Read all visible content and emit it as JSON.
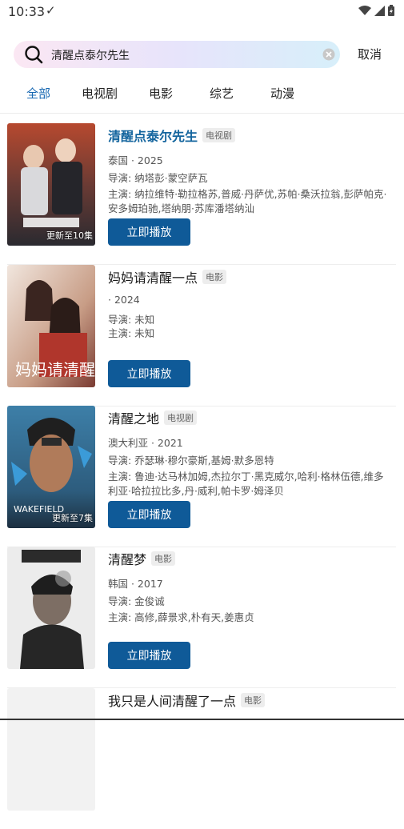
{
  "status_bar": {
    "time": "10:33",
    "check": "✓"
  },
  "search": {
    "query": "清醒点泰尔先生",
    "cancel_label": "取消"
  },
  "tabs": [
    {
      "label": "全部",
      "active": true
    },
    {
      "label": "电视剧",
      "active": false
    },
    {
      "label": "电影",
      "active": false
    },
    {
      "label": "综艺",
      "active": false
    },
    {
      "label": "动漫",
      "active": false
    }
  ],
  "results": [
    {
      "title": "清醒点泰尔先生",
      "tag": "电视剧",
      "meta": "泰国 · 2025",
      "director": "导演:  纳塔彭·蒙空萨瓦",
      "cast": "主演:  纳拉维特·勒拉格苏,普威·丹萨优,苏帕·桑沃拉翁,彭萨帕克·安多姆珀驰,塔纳朋·苏库潘塔纳汕",
      "badge": "更新至10集",
      "play_label": "立即播放"
    },
    {
      "title": "妈妈请清醒一点",
      "tag": "电影",
      "meta": " · 2024",
      "director": "导演:  未知",
      "cast": "主演:  未知",
      "badge": "",
      "play_label": "立即播放"
    },
    {
      "title": "清醒之地",
      "tag": "电视剧",
      "meta": "澳大利亚 · 2021",
      "director": "导演:  乔瑟琳·穆尔豪斯,基姆·默多恩特",
      "cast": "主演:  鲁迪·达马林加姆,杰拉尔丁·黑克威尔,哈利·格林伍德,维多利亚·哈拉拉比多,丹·威利,帕卡罗·姆泽贝",
      "badge": "更新至7集",
      "play_label": "立即播放"
    },
    {
      "title": "清醒梦",
      "tag": "电影",
      "meta": "韩国 · 2017",
      "director": "导演:  金俊诚",
      "cast": "主演:  高修,薛景求,朴有天,姜惠贞",
      "badge": "",
      "play_label": "立即播放"
    },
    {
      "title": "我只是人间清醒了一点",
      "tag": "电影",
      "meta": "",
      "director": "",
      "cast": "",
      "badge": "",
      "play_label": ""
    }
  ]
}
